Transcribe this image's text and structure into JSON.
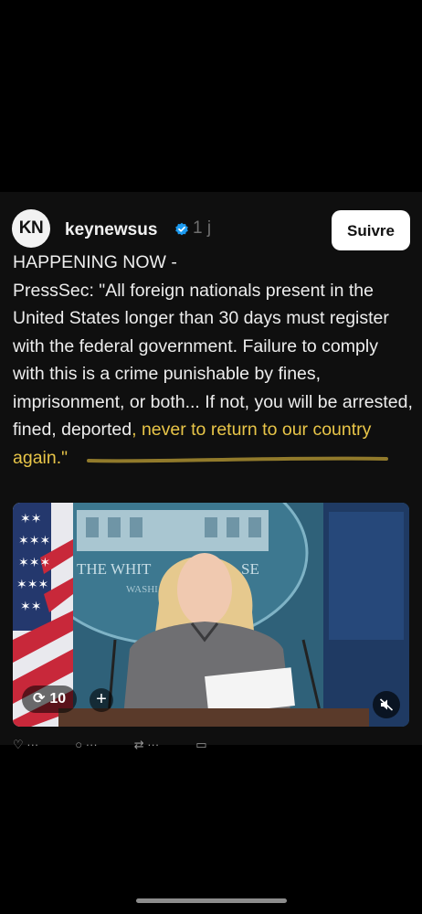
{
  "post": {
    "avatar_initials": "KN",
    "username": "keynewsus",
    "time_ago": "1 j",
    "follow_label": "Suivre",
    "caption_line1": "HAPPENING NOW -",
    "caption_body": "PressSec: \"All foreign nationals present in the United States longer than 30 days must register with the federal government. Failure to comply with this is a crime punishable by fines, imprisonment, or both... If not, you will be arrested, fined, deported",
    "caption_highlight": ", never to return to our country again.\"",
    "highlight_color": "#e8c548",
    "verified_color": "#1d9bf0",
    "backdrop_text_line1": "THE WHIT",
    "backdrop_text_line1b": "SE",
    "backdrop_text_line2": "WASHI",
    "repost_count": "10",
    "plus_label": "+",
    "action_icons": [
      "heart-icon",
      "comment-icon",
      "repost-icon",
      "share-icon"
    ]
  }
}
